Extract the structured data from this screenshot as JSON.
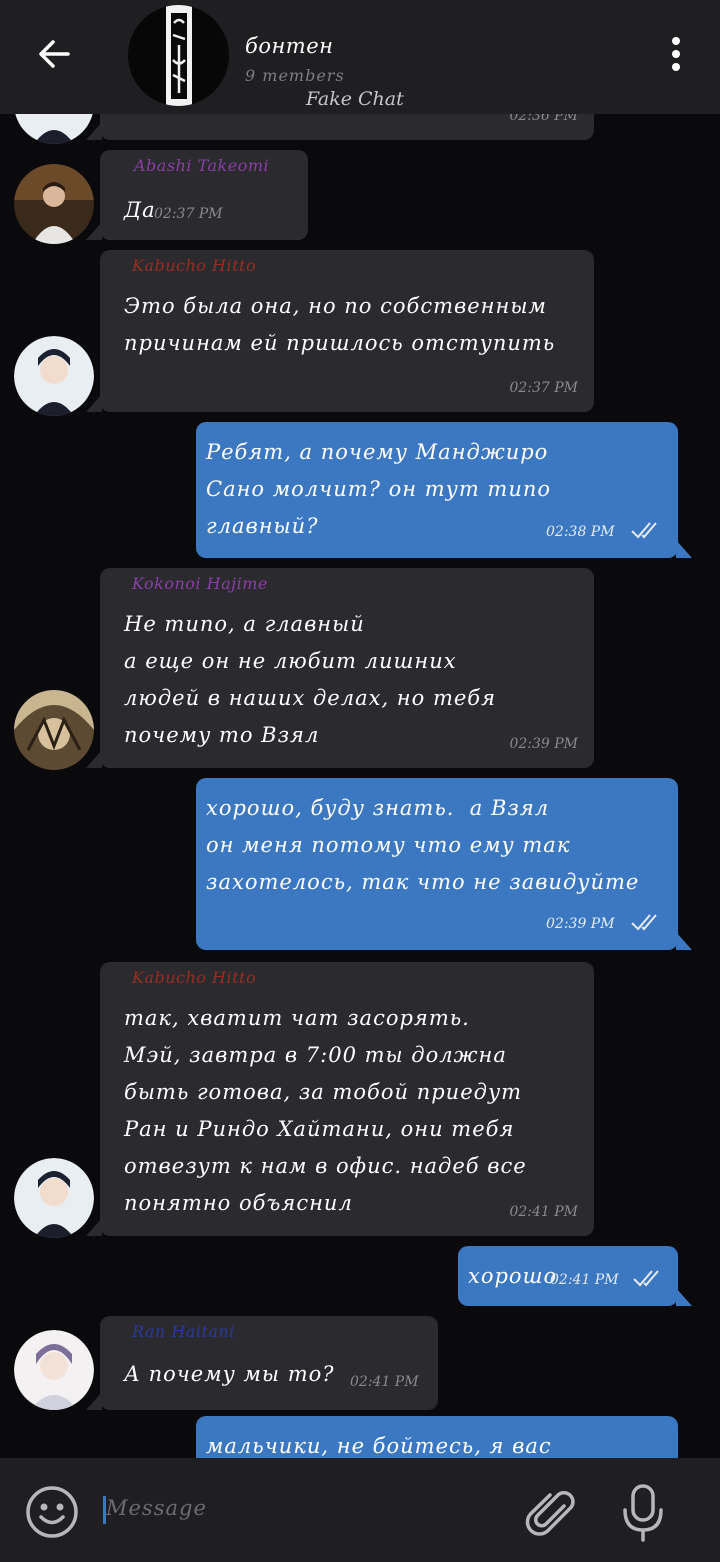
{
  "header": {
    "title": "бонтен",
    "subtitle": "9 members",
    "watermark": "Fake Chat"
  },
  "partial_top": {
    "time": "02:36 PM"
  },
  "messages": [
    {
      "sender": "Abashi Takeomi",
      "sender_color": "#8a3fa8",
      "text": "Да",
      "time": "02:37 PM"
    },
    {
      "sender": "Kabucho Hitto",
      "sender_color": "#9a2c22",
      "text": "Это была она, но по собственным\nпричинам ей пришлось отступить",
      "time": "02:37 PM"
    },
    {
      "text": "Ребят, а почему Манджиро\nСано молчит? он тут типо\nглавный?",
      "time": "02:38 PM"
    },
    {
      "sender": "Kokonoi Hajime",
      "sender_color": "#8a3fa8",
      "text": "Не типо, а главный\nа еще он не любит лишних\nлюдей в наших делах, но тебя\nпочему то Взял",
      "time": "02:39 PM"
    },
    {
      "text": "хорошо, буду знать.  а Взял\nон меня потому что ему так\nзахотелось, так что не завидуйте",
      "time": "02:39 PM"
    },
    {
      "sender": "Kabucho Hitto",
      "sender_color": "#9a2c22",
      "text": "так, хватит чат засорять.\nМэй, завтра в 7:00 ты должна\nбыть готова, за тобой приедут\nРан и Риндо Хайтани, они тебя\nотвезут к нам в офис. надеб все\nпонятно объяснил",
      "time": "02:41 PM"
    },
    {
      "text": "хорошо",
      "time": "02:41 PM"
    },
    {
      "sender": "Ran Haitani",
      "sender_color": "#2a3a9e",
      "text": "А почему мы то?",
      "time": "02:41 PM"
    },
    {
      "text": "мальчики, не бойтесь, я вас"
    }
  ],
  "input": {
    "placeholder": "Message"
  },
  "colors": {
    "accent": "#3c78c1",
    "incoming_bubble": "#2b2a2e",
    "header_bg": "#1f1e21"
  }
}
